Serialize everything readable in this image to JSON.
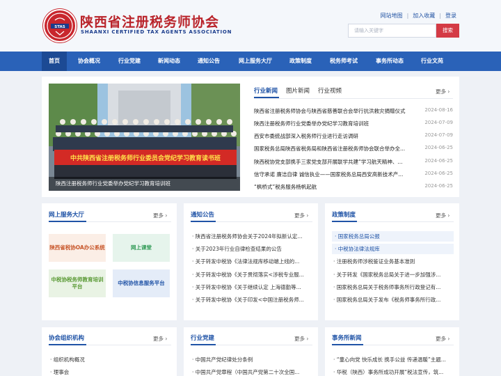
{
  "header": {
    "logo_cn": "陕西省注册税务师协会",
    "logo_en": "SHAANXI CERTIFIED TAX AGENTS ASSOCIATION",
    "logo_mark_text": "STAS",
    "links": [
      "网站地图",
      "加入收藏",
      "登录"
    ],
    "search_placeholder": "请输入关键字",
    "search_button": "搜索"
  },
  "nav": [
    "首页",
    "协会概况",
    "行业党建",
    "新闻动态",
    "通知公告",
    "网上服务大厅",
    "政策制度",
    "税务师考试",
    "事务所动态",
    "行业文苑"
  ],
  "slider": {
    "banner_text": "中共陕西省注册税务师行业委员会党纪学习教育读书班",
    "caption": "陕西注册税务师行业党委举办党纪学习教育培训班"
  },
  "news": {
    "tabs": [
      "行业新闻",
      "图片新闻",
      "行业视频"
    ],
    "more": "更多",
    "items": [
      {
        "title": "陕西省注册税务师协会与陕西省慈善联合会举行抗洪救灾捐赠仪式",
        "date": "2024-08-16"
      },
      {
        "title": "陕西注册税务师行业党委举办党纪学习教育培训班",
        "date": "2024-07-09"
      },
      {
        "title": "西安市委统战部深入税务师行业进行走访调研",
        "date": "2024-07-09"
      },
      {
        "title": "国家税务总局陕西省税务局和陕西省注册税务师协会联合举办全...",
        "date": "2024-06-25"
      },
      {
        "title": "陕西税协党支部携手三家党支部开展联学共建“学习航天精神、...",
        "date": "2024-06-25"
      },
      {
        "title": "信守承诺 廉洁自律 诚信执业——国家税务总局西安高新技术产...",
        "date": "2024-06-25"
      },
      {
        "title": "“枫桥式”税务服务杨帆起航",
        "date": "2024-06-25"
      }
    ]
  },
  "service": {
    "title": "网上服务大厅",
    "more": "更多",
    "buttons": [
      {
        "label": "陕西省税协OA办公系统",
        "bg": "#fbeee6",
        "fg": "#c8562a"
      },
      {
        "label": "网上课堂",
        "bg": "#e6f4ec",
        "fg": "#2f9a55"
      },
      {
        "label": "中税协税务师教育培训平台",
        "bg": "#e9f3e4",
        "fg": "#5a9a35"
      },
      {
        "label": "中税协信息服务平台",
        "bg": "#e4ecf8",
        "fg": "#2456a8"
      }
    ]
  },
  "notice": {
    "title": "通知公告",
    "more": "更多",
    "items": [
      "陕西省注册税务师协会关于2024年拟新认定...",
      "关于2023年行业自律检查结果的公告",
      "关于转发中税协《法律法规库移动端上线的...",
      "关于转发中税协《关于贯彻落实<涉税专业服...",
      "关于转发中税协《关于继续认定 上海德勤等...",
      "关于转发中税协《关于印发<中国注册税务师..."
    ]
  },
  "policy": {
    "title": "政策制度",
    "more": "更多",
    "items": [
      "国家税务总局公报",
      "中税协法律法规库",
      "注册税务师涉税鉴证业务基本准则",
      "关于转发《国家税务总局关于进一步加强涉...",
      "国家税务总局关于税务师事务所行政登记有...",
      "国家税务总局关于发布《税务师事务所行政..."
    ]
  },
  "org": {
    "title": "协会组织机构",
    "more": "更多",
    "items": [
      "组织机构概况",
      "理事会"
    ]
  },
  "party": {
    "title": "行业党建",
    "more": "更多",
    "items": [
      "中国共产党纪律处分条例",
      "中国共产党章程（中国共产党第二十次全国..."
    ]
  },
  "firm": {
    "title": "事务所新闻",
    "more": "更多",
    "items": [
      "“童心向党 快乐成长 携手公益 传递温暖”主题...",
      "华税（陕西）事务所成功开展“税法宣传，筑..."
    ]
  }
}
